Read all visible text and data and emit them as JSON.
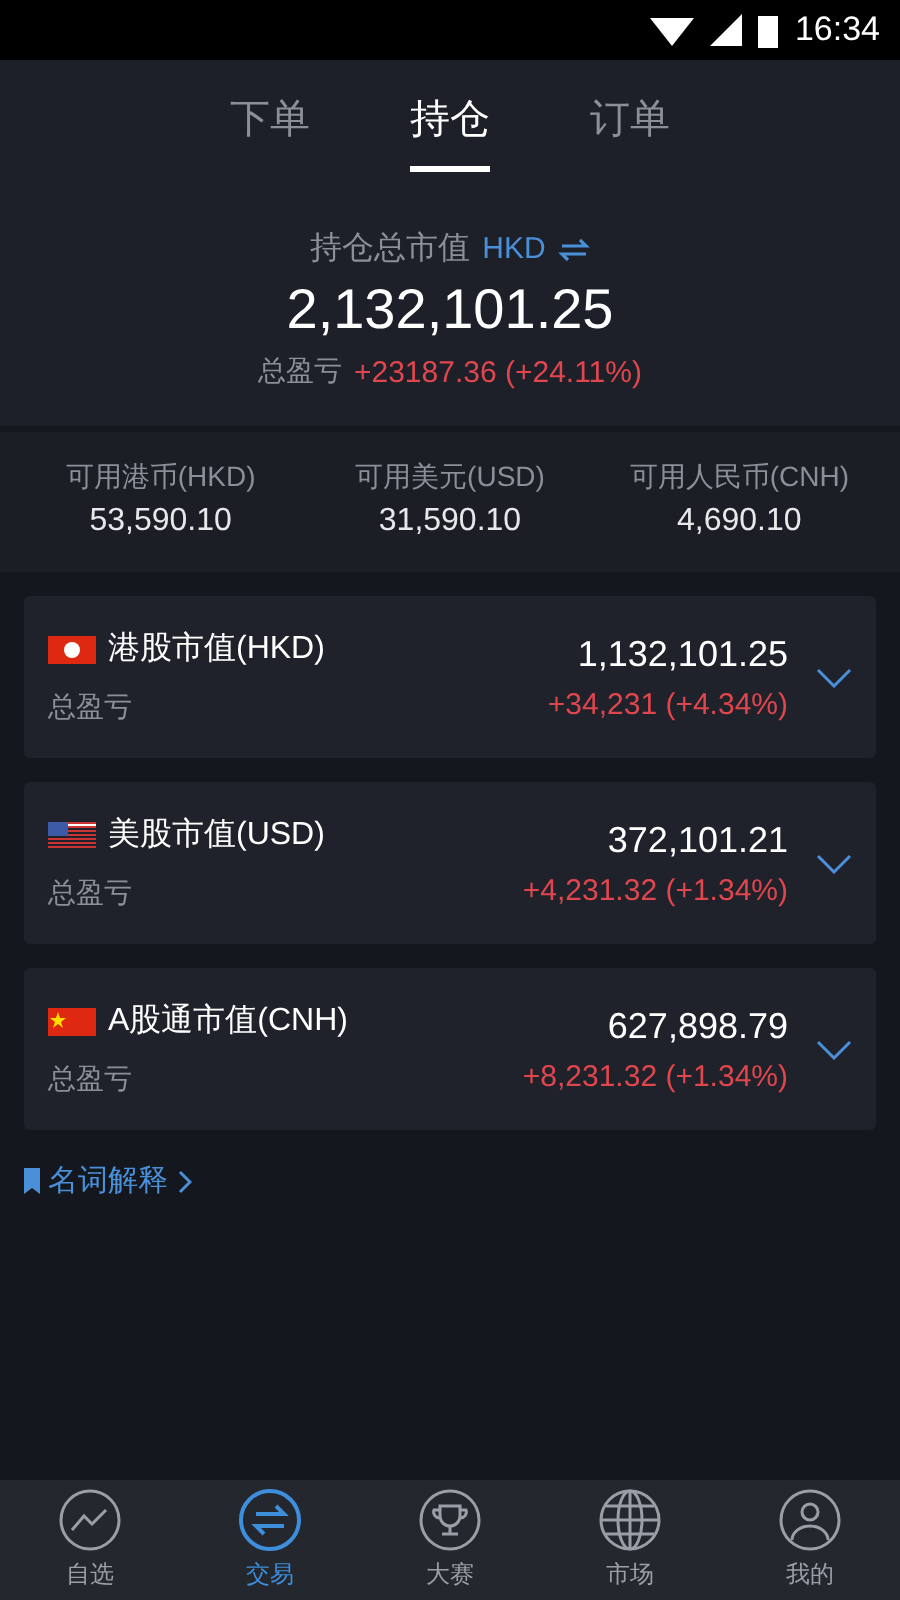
{
  "status_bar": {
    "time": "16:34"
  },
  "tabs": [
    {
      "label": "下单",
      "selected": false
    },
    {
      "label": "持仓",
      "selected": true
    },
    {
      "label": "订单",
      "selected": false
    }
  ],
  "summary": {
    "label": "持仓总市值",
    "currency": "HKD",
    "value": "2,132,101.25",
    "pnl_label": "总盈亏",
    "pnl": "+23187.36 (+24.11%)"
  },
  "balances": [
    {
      "label": "可用港币(HKD)",
      "value": "53,590.10"
    },
    {
      "label": "可用美元(USD)",
      "value": "31,590.10"
    },
    {
      "label": "可用人民币(CNH)",
      "value": "4,690.10"
    }
  ],
  "markets": [
    {
      "kind": "hk",
      "title": "港股市值(HKD)",
      "value": "1,132,101.25",
      "pnl_label": "总盈亏",
      "pnl": "+34,231 (+4.34%)",
      "expanded": false
    },
    {
      "kind": "us",
      "title": "美股市值(USD)",
      "value": "372,101.21",
      "pnl_label": "总盈亏",
      "pnl": "+4,231.32 (+1.34%)",
      "expanded": false
    },
    {
      "kind": "cn",
      "title": "A股通市值(CNH)",
      "value": "627,898.79",
      "pnl_label": "总盈亏",
      "pnl": "+8,231.32 (+1.34%)",
      "expanded": false
    }
  ],
  "glossary_link": "名词解释",
  "nav": [
    {
      "kind": "watchlist",
      "label": "自选",
      "selected": false
    },
    {
      "kind": "trade",
      "label": "交易",
      "selected": true
    },
    {
      "kind": "contest",
      "label": "大赛",
      "selected": false
    },
    {
      "kind": "market",
      "label": "市场",
      "selected": false
    },
    {
      "kind": "profile",
      "label": "我的",
      "selected": false
    }
  ]
}
